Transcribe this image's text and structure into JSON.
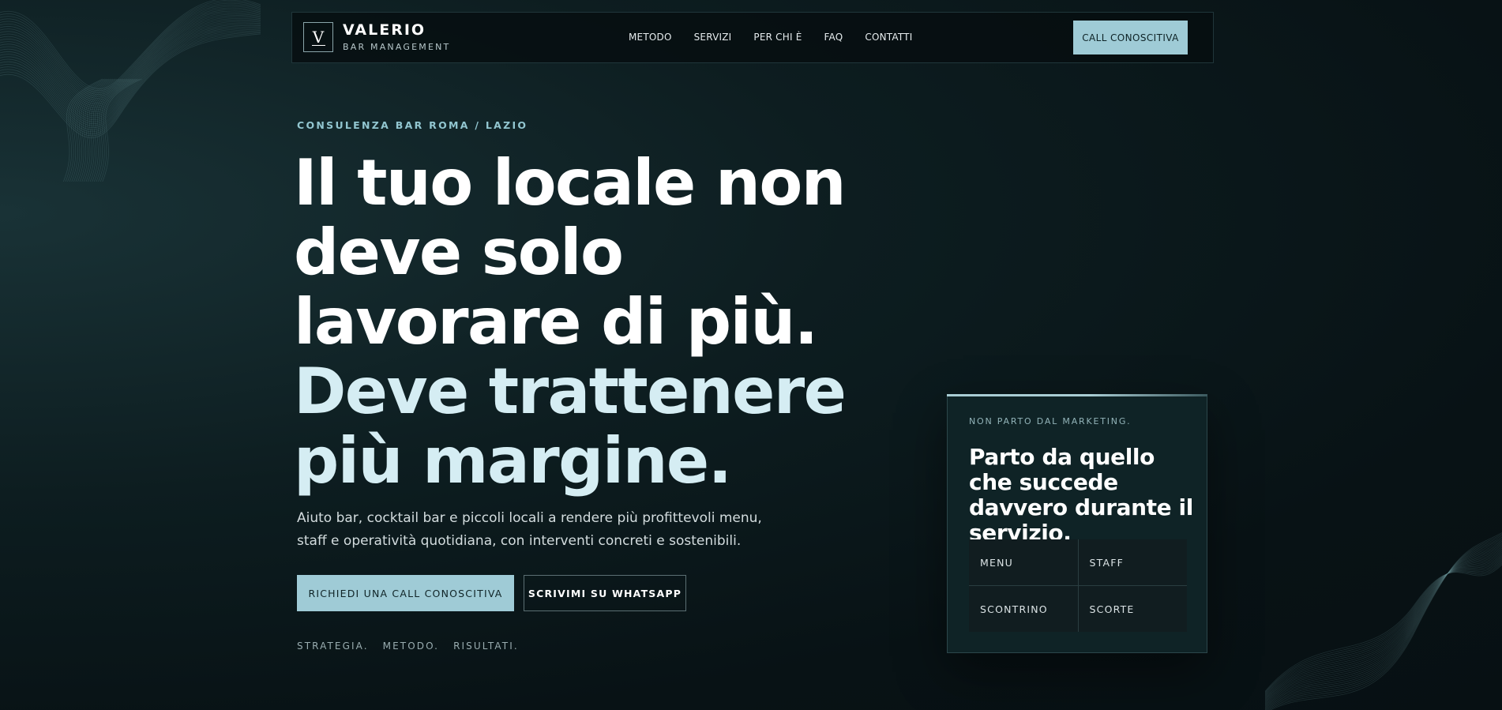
{
  "navbar": {
    "logo_letter": "V",
    "brand_name": "VALERIO",
    "brand_subtitle": "BAR MANAGEMENT",
    "links": [
      "METODO",
      "SERVIZI",
      "PER CHI È",
      "FAQ",
      "CONTATTI"
    ],
    "cta_label": "CALL CONOSCITIVA"
  },
  "hero": {
    "eyebrow": "CONSULENZA BAR ROMA / LAZIO",
    "headline_white": [
      "Il tuo locale non",
      "deve solo",
      "lavorare di più."
    ],
    "headline_accent": [
      "Deve trattenere",
      "più margine."
    ],
    "lead": "Aiuto bar, cocktail bar e piccoli locali a rendere più profittevoli menu, staff e operatività quotidiana, con interventi concreti e sostenibili.",
    "primary_button": "RICHIEDI UNA CALL CONOSCITIVA",
    "secondary_button": "SCRIVIMI SU WHATSAPP",
    "tagline": [
      "STRATEGIA.",
      "METODO.",
      "RISULTATI."
    ]
  },
  "card": {
    "eyebrow": "NON PARTO DAL MARKETING.",
    "title": "Parto da quello che succede davvero durante il servizio.",
    "cells": [
      "MENU",
      "STAFF",
      "SCONTRINO",
      "SCORTE"
    ]
  },
  "colors": {
    "accent": "#9fcbd6",
    "headline_accent": "#d5edf3",
    "background": "#0b181b"
  }
}
